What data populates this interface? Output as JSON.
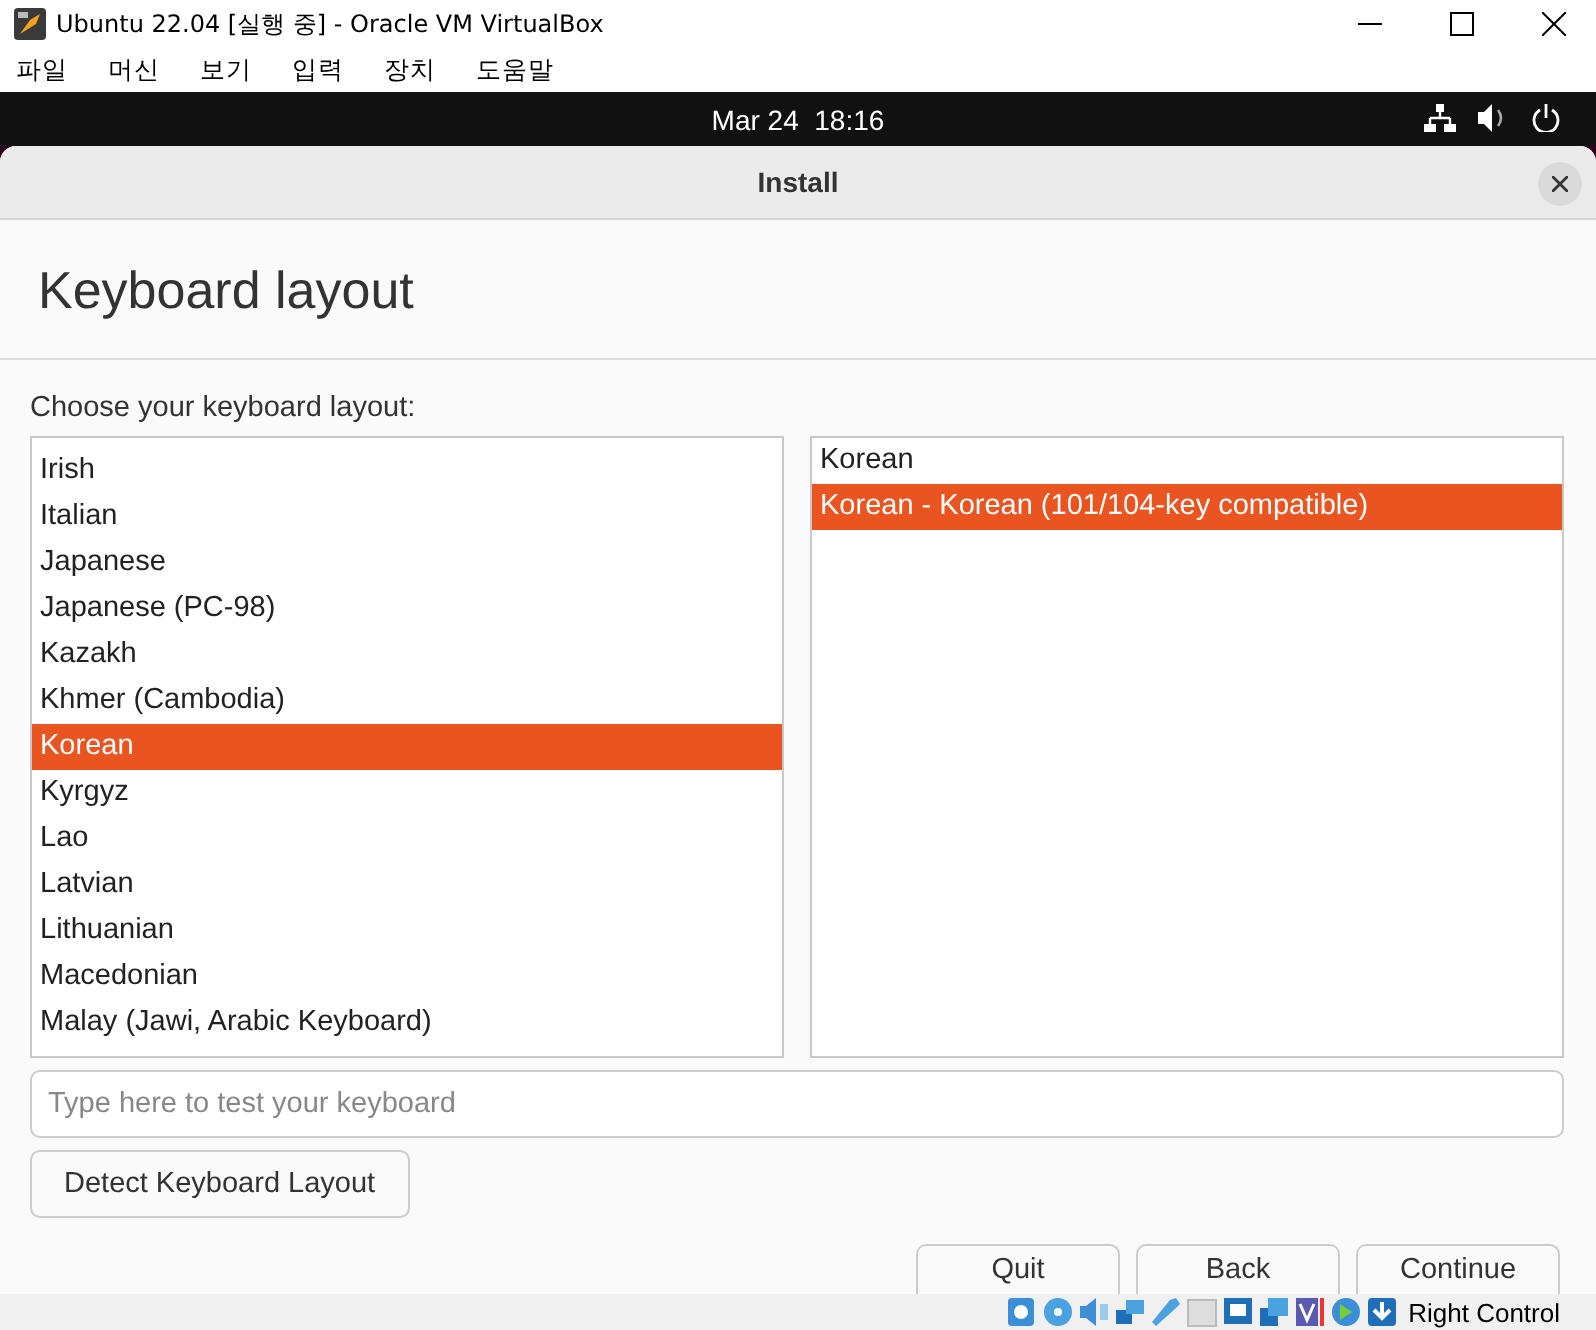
{
  "window": {
    "title": "Ubuntu 22.04 [실행 중] - Oracle VM VirtualBox"
  },
  "menu": [
    "파일",
    "머신",
    "보기",
    "입력",
    "장치",
    "도움말"
  ],
  "top_bar": {
    "clock": "Mar 24  18:16"
  },
  "dialog": {
    "title": "Install",
    "heading": "Keyboard layout",
    "prompt": "Choose your keyboard layout:",
    "layouts": [
      {
        "label": "Irish",
        "selected": false
      },
      {
        "label": "Italian",
        "selected": false
      },
      {
        "label": "Japanese",
        "selected": false
      },
      {
        "label": "Japanese (PC-98)",
        "selected": false
      },
      {
        "label": "Kazakh",
        "selected": false
      },
      {
        "label": "Khmer (Cambodia)",
        "selected": false
      },
      {
        "label": "Korean",
        "selected": true
      },
      {
        "label": "Kyrgyz",
        "selected": false
      },
      {
        "label": "Lao",
        "selected": false
      },
      {
        "label": "Latvian",
        "selected": false
      },
      {
        "label": "Lithuanian",
        "selected": false
      },
      {
        "label": "Macedonian",
        "selected": false
      },
      {
        "label": "Malay (Jawi, Arabic Keyboard)",
        "selected": false
      }
    ],
    "variants": [
      {
        "label": "Korean",
        "selected": false
      },
      {
        "label": "Korean - Korean (101/104-key compatible)",
        "selected": true
      }
    ],
    "test_field": {
      "placeholder": "Type here to test your keyboard"
    },
    "detect_button": "Detect Keyboard Layout",
    "buttons": [
      "Quit",
      "Back",
      "Continue"
    ]
  },
  "status_bar": {
    "host_key": "Right Control"
  }
}
